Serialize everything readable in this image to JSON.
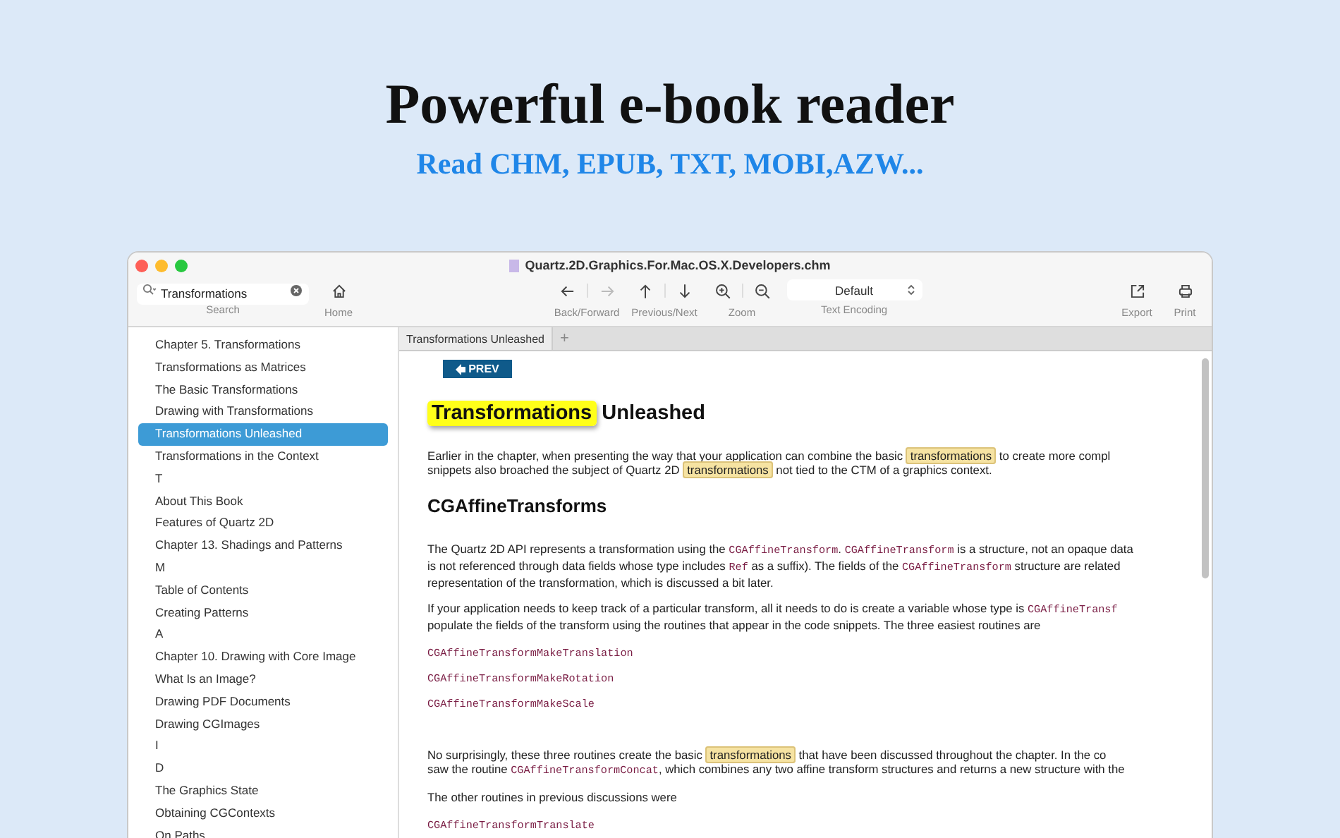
{
  "header": {
    "title": "Powerful e-book reader",
    "subtitle": "Read CHM, EPUB, TXT, MOBI,AZW..."
  },
  "window": {
    "title": "Quartz.2D.Graphics.For.Mac.OS.X.Developers.chm"
  },
  "toolbar": {
    "search": {
      "value": "Transformations",
      "label": "Search"
    },
    "groups": [
      {
        "kind": "home",
        "label": "Home",
        "buttons": [
          {
            "kind": "home",
            "disabled": false
          }
        ]
      },
      {
        "kind": "spacer"
      },
      {
        "kind": "pair",
        "label": "Back/Forward",
        "buttons": [
          {
            "kind": "back",
            "disabled": false
          },
          {
            "kind": "forward",
            "disabled": true
          }
        ]
      },
      {
        "kind": "pair",
        "label": "Previous/Next",
        "buttons": [
          {
            "kind": "up",
            "disabled": false
          },
          {
            "kind": "down",
            "disabled": false
          }
        ]
      },
      {
        "kind": "pair",
        "label": "Zoom",
        "buttons": [
          {
            "kind": "zoom_in",
            "disabled": false
          },
          {
            "kind": "zoom_out",
            "disabled": false
          }
        ]
      },
      {
        "kind": "select",
        "label": "Text Encoding",
        "value": "Default"
      },
      {
        "kind": "spacer"
      },
      {
        "kind": "single",
        "label": "Export",
        "buttons": [
          {
            "kind": "export",
            "disabled": false
          }
        ]
      },
      {
        "kind": "single",
        "label": "Print",
        "buttons": [
          {
            "kind": "print",
            "disabled": false
          }
        ]
      }
    ]
  },
  "sidebar": {
    "items": [
      {
        "label": "Chapter 5.  Transformations",
        "selected": false
      },
      {
        "label": "Transformations as Matrices",
        "selected": false
      },
      {
        "label": "The Basic Transformations",
        "selected": false
      },
      {
        "label": "Drawing with Transformations",
        "selected": false
      },
      {
        "label": "Transformations Unleashed",
        "selected": true
      },
      {
        "label": "Transformations in the Context",
        "selected": false
      },
      {
        "label": "T",
        "selected": false
      },
      {
        "label": "About This Book",
        "selected": false
      },
      {
        "label": "Features of Quartz 2D",
        "selected": false
      },
      {
        "label": "Chapter 13.  Shadings and Patterns",
        "selected": false
      },
      {
        "label": "M",
        "selected": false
      },
      {
        "label": "Table of Contents",
        "selected": false
      },
      {
        "label": "Creating Patterns",
        "selected": false
      },
      {
        "label": "A",
        "selected": false
      },
      {
        "label": "Chapter 10.  Drawing with Core Image",
        "selected": false
      },
      {
        "label": "What Is an Image?",
        "selected": false
      },
      {
        "label": "Drawing PDF Documents",
        "selected": false
      },
      {
        "label": "Drawing CGImages",
        "selected": false
      },
      {
        "label": "I",
        "selected": false
      },
      {
        "label": "D",
        "selected": false
      },
      {
        "label": "The Graphics State",
        "selected": false
      },
      {
        "label": "Obtaining CGContexts",
        "selected": false
      },
      {
        "label": "On Paths",
        "selected": false
      }
    ]
  },
  "tabs": [
    {
      "label": "Transformations Unleashed",
      "selected": true
    }
  ],
  "new_tab": "+",
  "document": {
    "prev_button": "PREV",
    "blocks": [
      {
        "kind": "h1",
        "lines": [
          [
            {
              "kind": "hit",
              "text": "Transformations"
            },
            {
              "kind": "text",
              "text": " Unleashed"
            }
          ]
        ]
      },
      {
        "kind": "para",
        "lines": [
          [
            {
              "kind": "text",
              "text": "Earlier in the chapter, when presenting the way that your application can combine the basic "
            },
            {
              "kind": "hit",
              "text": "transformations"
            },
            {
              "kind": "text",
              "text": " to create more compl"
            }
          ],
          [
            {
              "kind": "text",
              "text": "snippets also broached the subject of Quartz 2D "
            },
            {
              "kind": "hit",
              "text": "transformations"
            },
            {
              "kind": "text",
              "text": " not tied to the CTM of a graphics context."
            }
          ]
        ]
      },
      {
        "kind": "h2",
        "lines": [
          [
            {
              "kind": "text",
              "text": "CGAffineTransforms"
            }
          ]
        ]
      },
      {
        "kind": "para",
        "lines": [
          [
            {
              "kind": "text",
              "text": "The Quartz 2D API represents a transformation using the "
            },
            {
              "kind": "code",
              "text": "CGAffineTransform"
            },
            {
              "kind": "text",
              "text": ". "
            },
            {
              "kind": "code",
              "text": "CGAffineTransform"
            },
            {
              "kind": "text",
              "text": " is a structure, not an opaque data"
            }
          ],
          [
            {
              "kind": "text",
              "text": "is not referenced through data fields whose type includes "
            },
            {
              "kind": "code",
              "text": "Ref"
            },
            {
              "kind": "text",
              "text": " as a suffix). The fields of the "
            },
            {
              "kind": "code",
              "text": "CGAffineTransform"
            },
            {
              "kind": "text",
              "text": " structure are related"
            }
          ],
          [
            {
              "kind": "text",
              "text": "representation of the transformation, which is discussed a bit later."
            }
          ]
        ]
      },
      {
        "kind": "para",
        "lines": [
          [
            {
              "kind": "text",
              "text": "If your application needs to keep track of a particular transform, all it needs to do is create a variable whose type is "
            },
            {
              "kind": "code",
              "text": "CGAffineTransf"
            }
          ],
          [
            {
              "kind": "text",
              "text": "populate the fields of the transform using the routines that appear in the code snippets. The three easiest routines are"
            }
          ]
        ]
      },
      {
        "kind": "code",
        "lines": [
          [
            {
              "kind": "code",
              "text": "CGAffineTransformMakeTranslation"
            }
          ]
        ]
      },
      {
        "kind": "code",
        "lines": [
          [
            {
              "kind": "code",
              "text": "CGAffineTransformMakeRotation"
            }
          ]
        ]
      },
      {
        "kind": "code",
        "lines": [
          [
            {
              "kind": "code",
              "text": "CGAffineTransformMakeScale"
            }
          ]
        ]
      },
      {
        "kind": "gap"
      },
      {
        "kind": "para",
        "lines": [
          [
            {
              "kind": "text",
              "text": "No surprisingly, these three routines create the basic "
            },
            {
              "kind": "hit",
              "text": "transformations"
            },
            {
              "kind": "text",
              "text": " that have been discussed throughout the chapter. In the co"
            }
          ],
          [
            {
              "kind": "text",
              "text": "saw the routine "
            },
            {
              "kind": "code",
              "text": "CGAffineTransformConcat"
            },
            {
              "kind": "text",
              "text": ", which combines any two affine transform structures and returns a new structure with the"
            }
          ]
        ]
      },
      {
        "kind": "para",
        "lines": [
          [
            {
              "kind": "text",
              "text": "The other routines in previous discussions were"
            }
          ]
        ]
      },
      {
        "kind": "code",
        "lines": [
          [
            {
              "kind": "code",
              "text": "CGAffineTransformTranslate"
            }
          ]
        ]
      }
    ]
  }
}
